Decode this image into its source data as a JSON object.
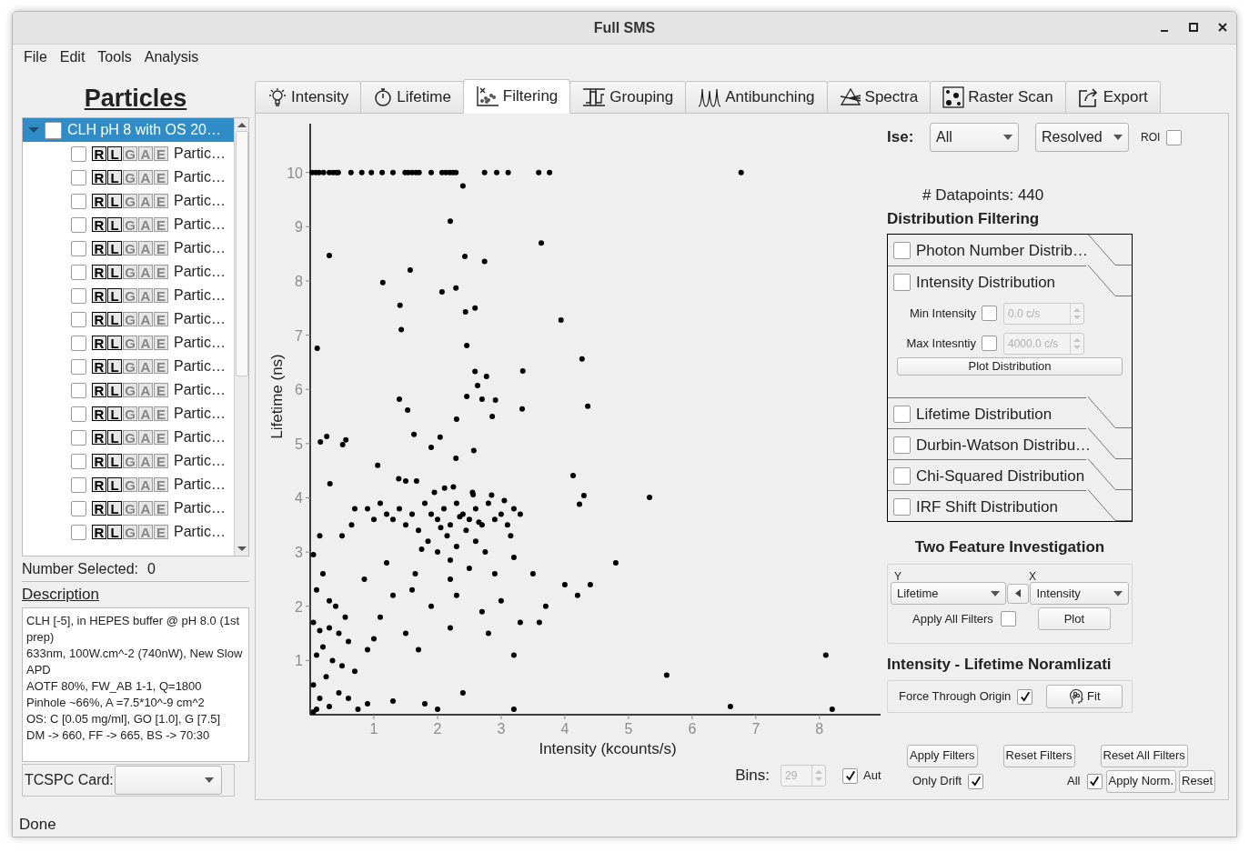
{
  "window": {
    "title": "Full SMS"
  },
  "menu": [
    "File",
    "Edit",
    "Tools",
    "Analysis"
  ],
  "sidebar": {
    "heading": "Particles",
    "tree": {
      "label": "CLH pH 8 with OS 20…",
      "expanded": true,
      "selected": true,
      "checked": false,
      "children": [
        {
          "label": "Partic…",
          "checked": false,
          "flags": [
            {
              "letter": "R",
              "on": true
            },
            {
              "letter": "L",
              "on": true
            },
            {
              "letter": "G",
              "on": false
            },
            {
              "letter": "A",
              "on": false
            },
            {
              "letter": "E",
              "on": false
            }
          ]
        },
        {
          "label": "Partic…",
          "checked": false,
          "flags": [
            {
              "letter": "R",
              "on": true
            },
            {
              "letter": "L",
              "on": true
            },
            {
              "letter": "G",
              "on": false
            },
            {
              "letter": "A",
              "on": false
            },
            {
              "letter": "E",
              "on": false
            }
          ]
        },
        {
          "label": "Partic…",
          "checked": false,
          "flags": [
            {
              "letter": "R",
              "on": true
            },
            {
              "letter": "L",
              "on": true
            },
            {
              "letter": "G",
              "on": false
            },
            {
              "letter": "A",
              "on": false
            },
            {
              "letter": "E",
              "on": false
            }
          ]
        },
        {
          "label": "Partic…",
          "checked": false,
          "flags": [
            {
              "letter": "R",
              "on": true
            },
            {
              "letter": "L",
              "on": true
            },
            {
              "letter": "G",
              "on": false
            },
            {
              "letter": "A",
              "on": false
            },
            {
              "letter": "E",
              "on": false
            }
          ]
        },
        {
          "label": "Partic…",
          "checked": false,
          "flags": [
            {
              "letter": "R",
              "on": true
            },
            {
              "letter": "L",
              "on": true
            },
            {
              "letter": "G",
              "on": false
            },
            {
              "letter": "A",
              "on": false
            },
            {
              "letter": "E",
              "on": false
            }
          ]
        },
        {
          "label": "Partic…",
          "checked": false,
          "flags": [
            {
              "letter": "R",
              "on": true
            },
            {
              "letter": "L",
              "on": true
            },
            {
              "letter": "G",
              "on": false
            },
            {
              "letter": "A",
              "on": false
            },
            {
              "letter": "E",
              "on": false
            }
          ]
        },
        {
          "label": "Partic…",
          "checked": false,
          "flags": [
            {
              "letter": "R",
              "on": true
            },
            {
              "letter": "L",
              "on": true
            },
            {
              "letter": "G",
              "on": false
            },
            {
              "letter": "A",
              "on": false
            },
            {
              "letter": "E",
              "on": false
            }
          ]
        },
        {
          "label": "Partic…",
          "checked": false,
          "flags": [
            {
              "letter": "R",
              "on": true
            },
            {
              "letter": "L",
              "on": true
            },
            {
              "letter": "G",
              "on": false
            },
            {
              "letter": "A",
              "on": false
            },
            {
              "letter": "E",
              "on": false
            }
          ]
        },
        {
          "label": "Partic…",
          "checked": false,
          "flags": [
            {
              "letter": "R",
              "on": true
            },
            {
              "letter": "L",
              "on": true
            },
            {
              "letter": "G",
              "on": false
            },
            {
              "letter": "A",
              "on": false
            },
            {
              "letter": "E",
              "on": false
            }
          ]
        },
        {
          "label": "Partic…",
          "checked": false,
          "flags": [
            {
              "letter": "R",
              "on": true
            },
            {
              "letter": "L",
              "on": true
            },
            {
              "letter": "G",
              "on": false
            },
            {
              "letter": "A",
              "on": false
            },
            {
              "letter": "E",
              "on": false
            }
          ]
        },
        {
          "label": "Partic…",
          "checked": false,
          "flags": [
            {
              "letter": "R",
              "on": true
            },
            {
              "letter": "L",
              "on": true
            },
            {
              "letter": "G",
              "on": false
            },
            {
              "letter": "A",
              "on": false
            },
            {
              "letter": "E",
              "on": false
            }
          ]
        },
        {
          "label": "Partic…",
          "checked": false,
          "flags": [
            {
              "letter": "R",
              "on": true
            },
            {
              "letter": "L",
              "on": true
            },
            {
              "letter": "G",
              "on": false
            },
            {
              "letter": "A",
              "on": false
            },
            {
              "letter": "E",
              "on": false
            }
          ]
        },
        {
          "label": "Partic…",
          "checked": false,
          "flags": [
            {
              "letter": "R",
              "on": true
            },
            {
              "letter": "L",
              "on": true
            },
            {
              "letter": "G",
              "on": false
            },
            {
              "letter": "A",
              "on": false
            },
            {
              "letter": "E",
              "on": false
            }
          ]
        },
        {
          "label": "Partic…",
          "checked": false,
          "flags": [
            {
              "letter": "R",
              "on": true
            },
            {
              "letter": "L",
              "on": true
            },
            {
              "letter": "G",
              "on": false
            },
            {
              "letter": "A",
              "on": false
            },
            {
              "letter": "E",
              "on": false
            }
          ]
        },
        {
          "label": "Partic…",
          "checked": false,
          "flags": [
            {
              "letter": "R",
              "on": true
            },
            {
              "letter": "L",
              "on": true
            },
            {
              "letter": "G",
              "on": false
            },
            {
              "letter": "A",
              "on": false
            },
            {
              "letter": "E",
              "on": false
            }
          ]
        },
        {
          "label": "Partic…",
          "checked": false,
          "flags": [
            {
              "letter": "R",
              "on": true
            },
            {
              "letter": "L",
              "on": true
            },
            {
              "letter": "G",
              "on": false
            },
            {
              "letter": "A",
              "on": false
            },
            {
              "letter": "E",
              "on": false
            }
          ]
        },
        {
          "label": "Partic…",
          "checked": false,
          "flags": [
            {
              "letter": "R",
              "on": true
            },
            {
              "letter": "L",
              "on": true
            },
            {
              "letter": "G",
              "on": false
            },
            {
              "letter": "A",
              "on": false
            },
            {
              "letter": "E",
              "on": false
            }
          ]
        }
      ]
    },
    "number_selected": {
      "label": "Number Selected:",
      "value": "0"
    },
    "description": {
      "heading": "Description",
      "lines": [
        "CLH [-5], in HEPES buffer @ pH 8.0 (1st prep)",
        "633nm, 100W.cm^-2 (740nW), New Slow APD",
        "AOTF 80%, FW_AB 1-1, Q=1800",
        "Pinhole ~66%, A =7.5*10^-9 cm^2",
        "OS: C [0.05 mg/ml], GO [1.0], G [7.5]",
        "DM -> 660, FF -> 665, BS -> 70:30"
      ]
    },
    "tcspc": {
      "label": "TCSPC Card:"
    }
  },
  "tabs": [
    {
      "label": "Intensity",
      "selected": false
    },
    {
      "label": "Lifetime",
      "selected": false
    },
    {
      "label": "Filtering",
      "selected": true
    },
    {
      "label": "Grouping",
      "selected": false
    },
    {
      "label": "Antibunching",
      "selected": false
    },
    {
      "label": "Spectra",
      "selected": false
    },
    {
      "label": "Raster Scan",
      "selected": false
    },
    {
      "label": "Export",
      "selected": false
    }
  ],
  "filtering": {
    "plot": {
      "chart_data": {
        "type": "scatter",
        "xlabel": "Intensity (kcounts/s)",
        "ylabel": "Lifetime (ns)",
        "xlim": [
          0,
          8.96
        ],
        "ylim": [
          0,
          10.9
        ],
        "xticks": [
          1,
          2,
          3,
          4,
          5,
          6,
          7,
          8
        ],
        "yticks": [
          1,
          2,
          3,
          4,
          5,
          6,
          7,
          8,
          9,
          10
        ],
        "x": [
          0.03,
          0.09,
          0.14,
          0.21,
          0.3,
          0.36,
          0.41,
          0.44,
          0.64,
          0.81,
          0.96,
          1.13,
          1.3,
          1.49,
          1.54,
          1.6,
          1.66,
          1.71,
          1.9,
          2.07,
          2.13,
          2.19,
          2.24,
          2.29,
          2.74,
          2.93,
          3.11,
          3.59,
          3.76,
          6.77,
          2.4,
          2.2,
          0.3,
          3.63,
          2.43,
          2.74,
          1.57,
          1.14,
          2.07,
          2.29,
          1.41,
          2.44,
          2.59,
          3.94,
          1.43,
          2.46,
          0.11,
          4.27,
          3.34,
          2.59,
          2.77,
          2.63,
          2.46,
          2.7,
          2.91,
          1.4,
          1.53,
          4.36,
          3.33,
          2.86,
          2.3,
          1.63,
          0.26,
          0.16,
          0.56,
          0.51,
          2.04,
          1.9,
          2.57,
          2.29,
          1.06,
          0.31,
          4.13,
          4.3,
          5.33,
          4.23,
          1.39,
          1.5,
          1.67,
          2.11,
          2.56,
          1.8,
          1.9,
          2.0,
          2.1,
          2.2,
          2.3,
          2.4,
          2.5,
          2.6,
          2.7,
          2.8,
          2.9,
          3.0,
          3.1,
          3.2,
          1.7,
          1.85,
          2.0,
          2.15,
          2.3,
          2.45,
          2.6,
          2.75,
          1.6,
          1.5,
          1.4,
          1.3,
          1.2,
          1.1,
          0.9,
          1.0,
          1.95,
          2.25,
          2.55,
          2.85,
          3.05,
          3.3,
          3.15,
          2.05,
          2.35,
          2.65,
          1.75,
          2.2,
          2.5,
          1.65,
          3.2,
          2.9,
          0.65,
          0.5,
          0.7,
          0.15,
          0.05,
          0.2,
          0.1,
          0.3,
          0.4,
          0.55,
          0.05,
          0.15,
          0.3,
          0.45,
          0.6,
          0.2,
          0.1,
          0.35,
          0.5,
          0.7,
          0.25,
          0.05,
          0.45,
          0.15,
          0.6,
          0.3,
          0.9,
          0.1,
          0.75,
          1.3,
          1.8,
          2.0,
          0.9,
          1.1,
          1.5,
          1.7,
          2.2,
          1.3,
          1.6,
          1.9,
          2.3,
          2.7,
          3.0,
          3.3,
          3.6,
          2.8,
          3.2,
          2.4,
          3.2,
          4.0,
          4.2,
          4.4,
          4.8,
          6.6,
          8.1,
          5.6,
          8.2,
          0.05,
          3.7,
          3.5,
          2.2,
          1.2,
          0.85,
          1.0
        ],
        "series": [
          {
            "color": "#000000",
            "values": [
              10,
              10,
              10,
              10,
              10,
              10,
              10,
              10,
              10,
              10,
              10,
              10,
              10,
              10,
              10,
              10,
              10,
              10,
              10,
              10,
              10,
              10,
              10,
              10,
              10,
              10,
              10,
              10,
              10,
              10,
              9.75,
              9.1,
              8.47,
              8.7,
              8.45,
              8.36,
              8.2,
              7.97,
              7.8,
              7.87,
              7.55,
              7.43,
              7.5,
              7.28,
              7.1,
              6.81,
              6.76,
              6.56,
              6.34,
              6.33,
              6.24,
              6.07,
              5.87,
              5.82,
              5.8,
              5.82,
              5.62,
              5.69,
              5.64,
              5.5,
              5.45,
              5.17,
              5.13,
              5.03,
              5.07,
              4.98,
              5.12,
              4.93,
              4.87,
              4.73,
              4.6,
              4.26,
              4.41,
              4.04,
              4.01,
              3.88,
              4.35,
              4.31,
              4.31,
              4.18,
              4.06,
              3.9,
              3.7,
              3.6,
              3.8,
              3.5,
              3.9,
              3.7,
              3.6,
              3.8,
              3.5,
              3.9,
              3.6,
              3.7,
              3.5,
              3.8,
              3.4,
              3.2,
              3.0,
              3.3,
              3.1,
              3.4,
              3.2,
              3.0,
              3.7,
              3.5,
              3.8,
              3.6,
              3.7,
              3.9,
              3.8,
              3.6,
              4.1,
              4.2,
              4.1,
              4.05,
              3.95,
              3.7,
              3.3,
              3.45,
              3.65,
              3.55,
              3.05,
              2.85,
              2.7,
              2.6,
              2.9,
              2.6,
              3.5,
              3.3,
              3.8,
              3.3,
              2.95,
              2.6,
              2.3,
              2.1,
              2.0,
              1.8,
              1.7,
              1.55,
              1.6,
              1.5,
              1.35,
              1.25,
              1.1,
              1.0,
              0.9,
              0.8,
              0.7,
              0.55,
              0.4,
              0.3,
              0.3,
              0.15,
              0.2,
              0.1,
              0.1,
              0.25,
              0.2,
              0.1,
              1.2,
              1.8,
              1.5,
              1.2,
              1.6,
              2.2,
              2.3,
              2.0,
              2.2,
              1.9,
              2.1,
              1.7,
              1.7,
              1.5,
              1.1,
              0.4,
              0.1,
              2.4,
              2.2,
              2.4,
              2.8,
              0.15,
              1.1,
              0.73,
              0.1,
              0.05,
              2.0,
              2.6,
              2.5,
              2.8,
              2.5,
              1.4
            ]
          }
        ]
      }
    },
    "bins": {
      "label": "Bins:",
      "value": "29",
      "disabled": true,
      "auto": {
        "label": "Aut",
        "checked": true
      }
    },
    "use": {
      "label": "lse:",
      "value": "All"
    },
    "mode": {
      "value": "Resolved"
    },
    "roi": {
      "label": "ROI",
      "checked": false
    },
    "datapoints": "# Datapoints: 440",
    "distribution": {
      "title": "Distribution Filtering",
      "sections": [
        {
          "label": "Photon Number Distrib…",
          "checked": false
        },
        {
          "label": "Intensity Distribution",
          "checked": false,
          "fields": [
            {
              "label": "Min Intensity",
              "checked": false,
              "value": "0.0 c/s",
              "disabled": true
            },
            {
              "label": "Max Intesntiy",
              "checked": false,
              "value": "4000.0 c/s",
              "disabled": true
            }
          ],
          "button": "Plot Distribution"
        },
        {
          "label": "Lifetime Distribution",
          "checked": false
        },
        {
          "label": "Durbin-Watson Distribu…",
          "checked": false
        },
        {
          "label": "Chi-Squared Distribution",
          "checked": false
        },
        {
          "label": "IRF Shift Distribution",
          "checked": false
        }
      ]
    },
    "two_feature": {
      "title": "Two Feature Investigation",
      "y": {
        "label": "Y",
        "value": "Lifetime"
      },
      "x": {
        "label": "X",
        "value": "Intensity"
      },
      "apply_all": {
        "label": "Apply All Filters",
        "checked": false
      },
      "plot_button": "Plot"
    },
    "normalization": {
      "title": "Intensity - Lifetime Noramlizati",
      "force_origin": {
        "label": "Force Through Origin",
        "checked": true
      },
      "fit_button": "Fit"
    },
    "filter_buttons": [
      "Apply Filters",
      "Reset Filters",
      "Reset All Filters"
    ],
    "only_drift": {
      "label": "Only Drift",
      "checked": true
    },
    "all": {
      "label": "All",
      "checked": true
    },
    "norm_buttons": [
      "Apply Norm.",
      "Reset"
    ]
  },
  "status_bar": "Done"
}
